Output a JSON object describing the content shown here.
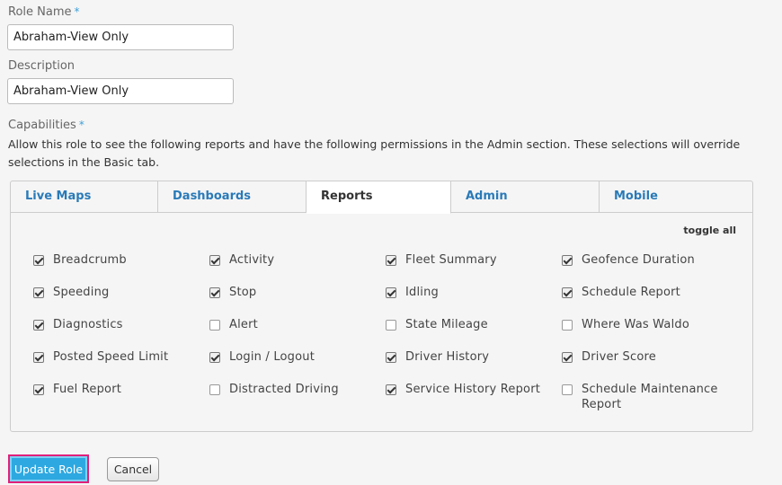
{
  "form": {
    "role_name_label": "Role Name",
    "role_name_value": "Abraham-View Only",
    "description_label": "Description",
    "description_value": "Abraham-View Only",
    "capabilities_label": "Capabilities",
    "required_mark": "*",
    "capabilities_help": "Allow this role to see the following reports and have the following permissions in the Admin section. These selections will override selections in the Basic tab."
  },
  "tabs": [
    {
      "label": "Live Maps",
      "active": false
    },
    {
      "label": "Dashboards",
      "active": false
    },
    {
      "label": "Reports",
      "active": true
    },
    {
      "label": "Admin",
      "active": false
    },
    {
      "label": "Mobile",
      "active": false
    }
  ],
  "toggle_all_label": "toggle all",
  "capabilities": [
    {
      "label": "Breadcrumb",
      "checked": true
    },
    {
      "label": "Activity",
      "checked": true
    },
    {
      "label": "Fleet Summary",
      "checked": true
    },
    {
      "label": "Geofence Duration",
      "checked": true
    },
    {
      "label": "Speeding",
      "checked": true
    },
    {
      "label": "Stop",
      "checked": true
    },
    {
      "label": "Idling",
      "checked": true
    },
    {
      "label": "Schedule Report",
      "checked": true
    },
    {
      "label": "Diagnostics",
      "checked": true
    },
    {
      "label": "Alert",
      "checked": false
    },
    {
      "label": "State Mileage",
      "checked": false
    },
    {
      "label": "Where Was Waldo",
      "checked": false
    },
    {
      "label": "Posted Speed Limit",
      "checked": true
    },
    {
      "label": "Login / Logout",
      "checked": true
    },
    {
      "label": "Driver History",
      "checked": true
    },
    {
      "label": "Driver Score",
      "checked": true
    },
    {
      "label": "Fuel Report",
      "checked": true
    },
    {
      "label": "Distracted Driving",
      "checked": false
    },
    {
      "label": "Service History Report",
      "checked": true
    },
    {
      "label": "Schedule Maintenance Report",
      "checked": false
    }
  ],
  "buttons": {
    "update_label": "Update Role",
    "cancel_label": "Cancel"
  },
  "colors": {
    "accent": "#2ea8e0",
    "highlight_border": "#e0207a",
    "tab_link": "#2a7ab8"
  }
}
